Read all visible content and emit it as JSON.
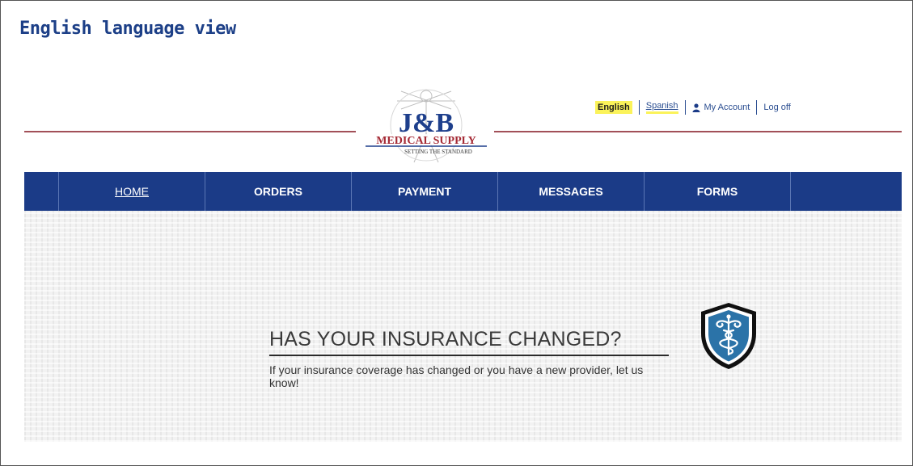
{
  "caption": "English language view",
  "logo": {
    "main": "J&B",
    "sub": "MEDICAL SUPPLY",
    "tagline": "SETTING THE STANDARD"
  },
  "topnav": {
    "english": "English",
    "spanish": "Spanish",
    "account": "My Account",
    "logoff": "Log off"
  },
  "mainnav": [
    {
      "label": "HOME"
    },
    {
      "label": "ORDERS"
    },
    {
      "label": "PAYMENT"
    },
    {
      "label": "MESSAGES"
    },
    {
      "label": "FORMS"
    }
  ],
  "banner": {
    "headline": "HAS YOUR INSURANCE CHANGED?",
    "body": "If your insurance coverage has changed or you have a new provider, let us know!"
  },
  "colors": {
    "nav": "#1b3b87",
    "highlight": "#fbf35a",
    "rule": "#a25058"
  }
}
